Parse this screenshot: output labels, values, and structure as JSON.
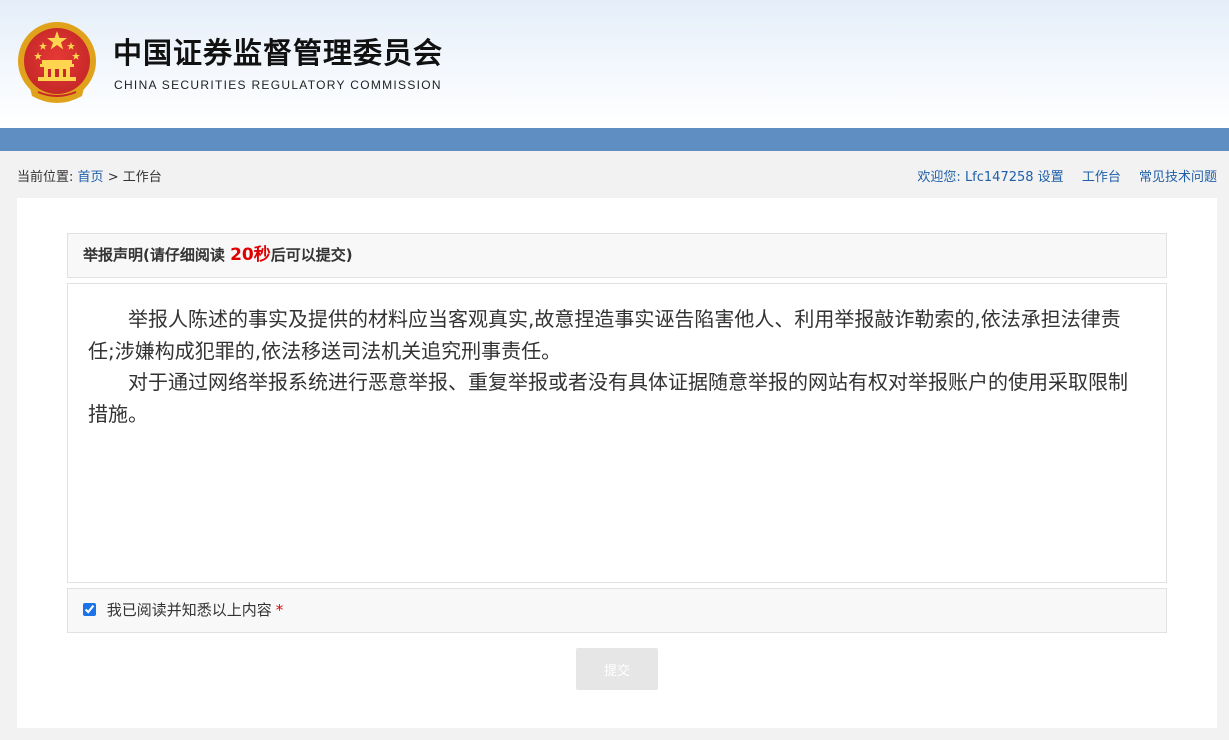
{
  "header": {
    "title_cn": "中国证券监督管理委员会",
    "title_en": "CHINA SECURITIES REGULATORY COMMISSION"
  },
  "breadcrumb": {
    "label": "当前位置:",
    "home": "首页",
    "separator": ">",
    "current": "工作台"
  },
  "userbar": {
    "welcome": "欢迎您:",
    "username": "Lfc147258",
    "settings": "设置",
    "workbench": "工作台",
    "faq": "常见技术问题"
  },
  "declaration": {
    "title_prefix": "举报声明(请仔细阅读 ",
    "seconds": "20秒",
    "title_suffix": "后可以提交)",
    "paragraphs": [
      "举报人陈述的事实及提供的材料应当客观真实,故意捏造事实诬告陷害他人、利用举报敲诈勒索的,依法承担法律责任;涉嫌构成犯罪的,依法移送司法机关追究刑事责任。",
      "对于通过网络举报系统进行恶意举报、重复举报或者没有具体证据随意举报的网站有权对举报账户的使用采取限制措施。"
    ]
  },
  "agree": {
    "label": "我已阅读并知悉以上内容",
    "required_mark": "*",
    "checked": true
  },
  "submit": {
    "label": "提交",
    "disabled": true
  },
  "colors": {
    "band": "#5f8fc2",
    "link": "#1f5fa8",
    "countdown": "#e00000"
  }
}
